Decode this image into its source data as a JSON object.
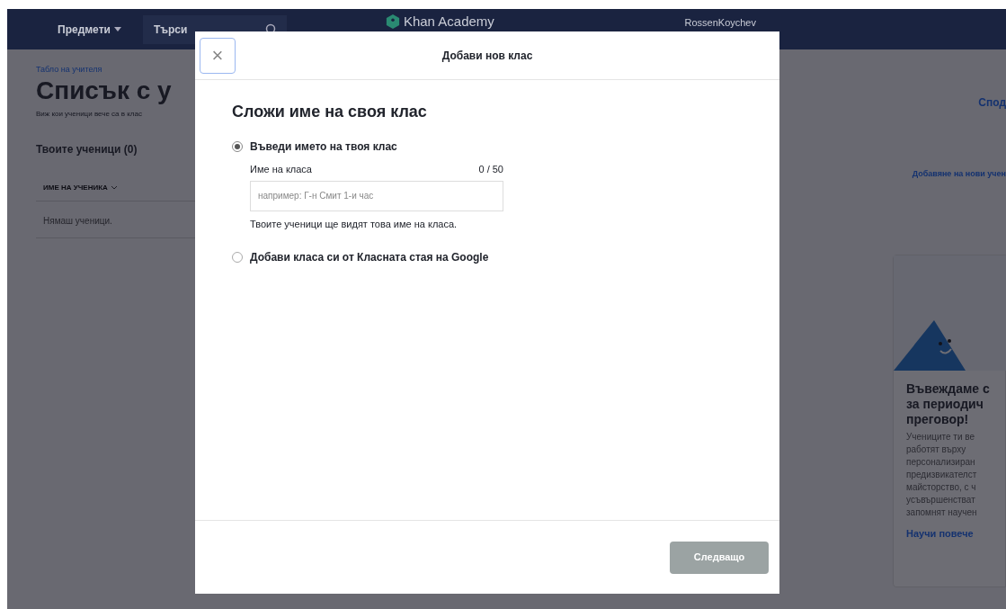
{
  "nav": {
    "subjects": "Предмети",
    "search": {
      "placeholder": "Търси"
    },
    "logo": "Khan Academy",
    "user": "RossenKoychev"
  },
  "page": {
    "breadcrumb": "Табло на учителя",
    "title": "Списък с у",
    "subtitle": "Виж кои ученици вече са в клас",
    "share_link": "Спод",
    "students_heading": "Твоите ученици (0)",
    "add_students_link": "Добавяне на нови учен",
    "column_1": "ИМЕ НА УЧЕНИКА",
    "empty_row": "Нямаш ученици."
  },
  "promo_card": {
    "title_lines": [
      "Въвеждаме с",
      "за периодич",
      "преговор!"
    ],
    "body_lines": [
      "Учениците ти ве",
      "работят върху",
      "персонализиран",
      "предизвикателст",
      "майсторство, с ч",
      "усъвършенстват",
      "запомнят научен"
    ],
    "link": "Научи повече"
  },
  "modal": {
    "close": "×",
    "title": "Добави нов клас",
    "heading": "Сложи име на своя клас",
    "options": [
      {
        "label": "Въведи името на твоя клас",
        "selected": true,
        "field": {
          "label": "Име на класа",
          "counter": "0 / 50",
          "placeholder": "например: Г-н Смит 1-и час",
          "hint": "Твоите ученици ще видят това име на класа."
        }
      },
      {
        "label": "Добави класа си от Класната стая на Google",
        "selected": false
      }
    ],
    "next_button": {
      "label": "Следващо",
      "disabled": true
    }
  }
}
